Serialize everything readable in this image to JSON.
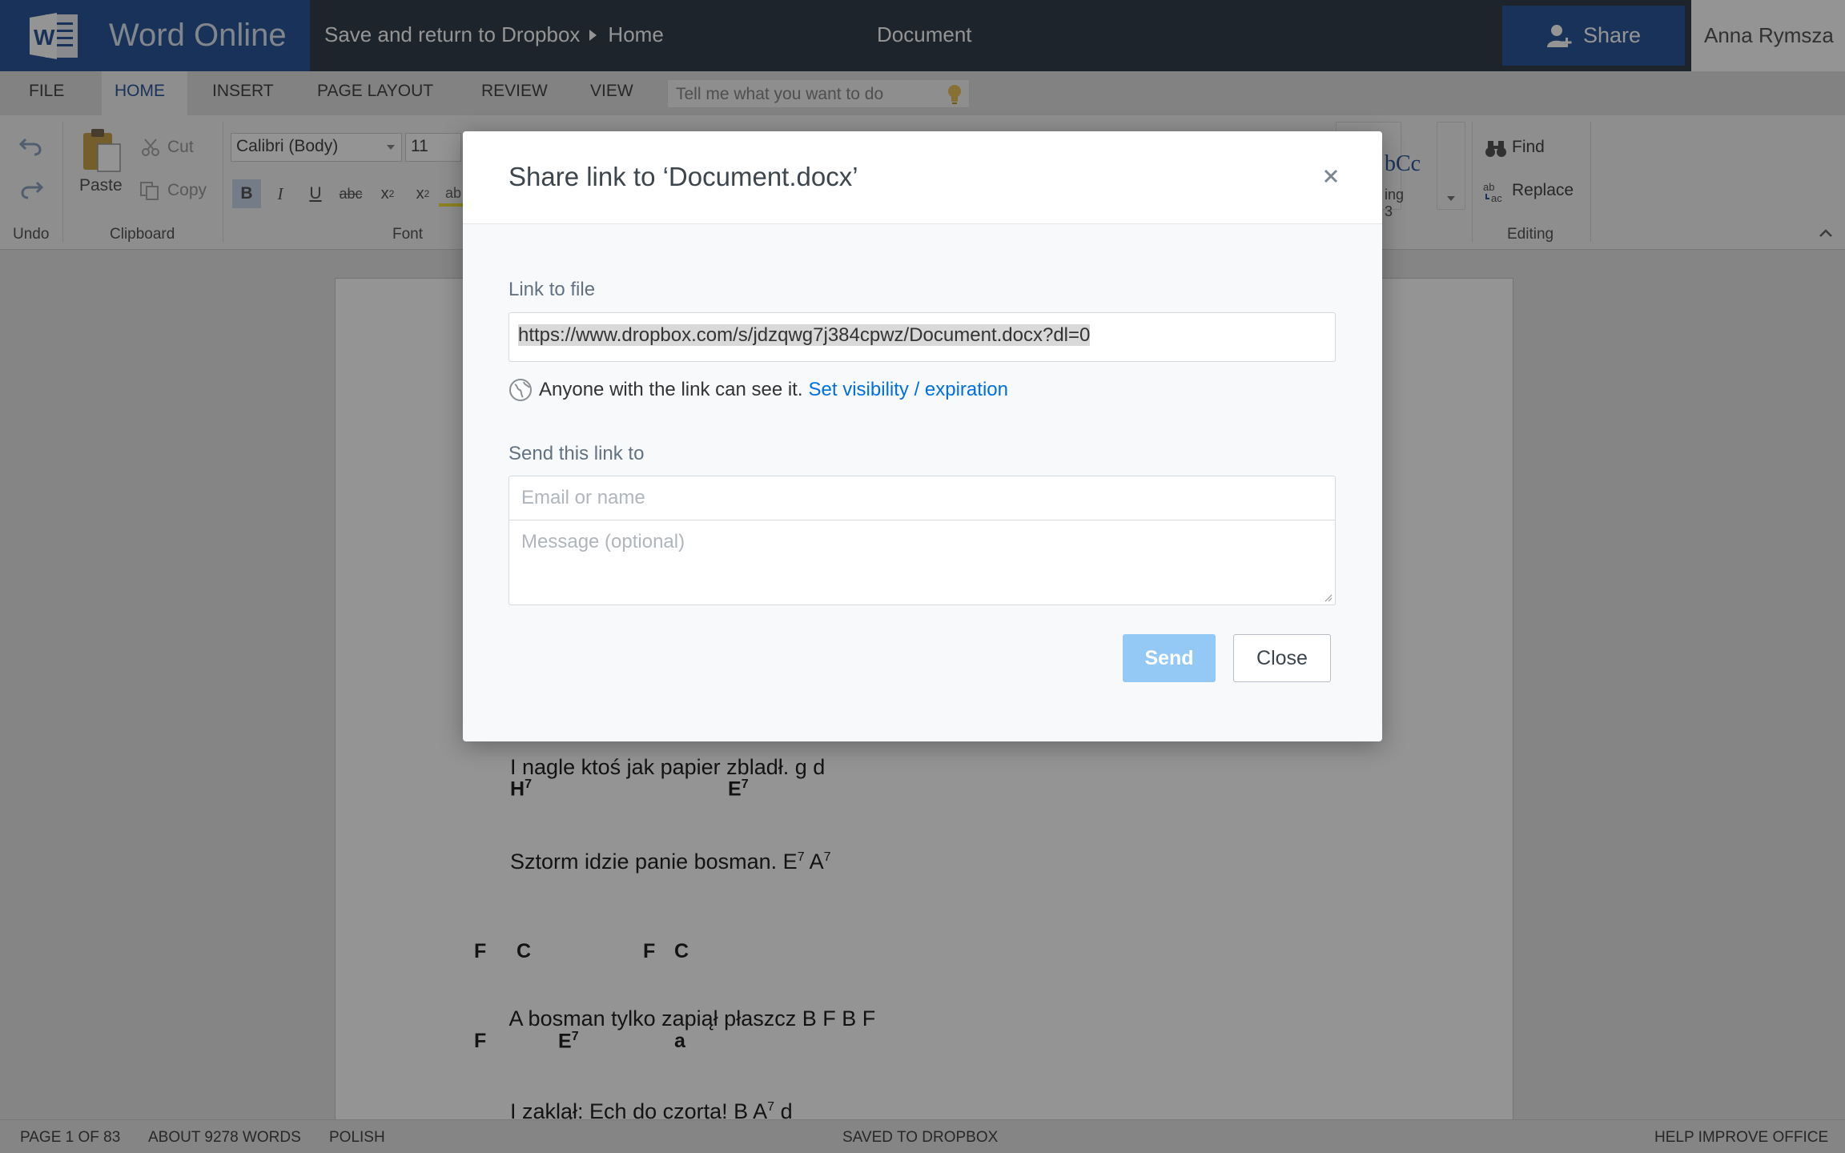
{
  "app": {
    "brand": "Word Online",
    "breadcrumb": [
      "Save and return to Dropbox",
      "Home"
    ],
    "document_title": "Document",
    "share_label": "Share",
    "user_name": "Anna Rymsza"
  },
  "tabs": [
    "FILE",
    "HOME",
    "INSERT",
    "PAGE LAYOUT",
    "REVIEW",
    "VIEW"
  ],
  "active_tab": "HOME",
  "tell_me_placeholder": "Tell me what you want to do",
  "ribbon": {
    "undo_group": "Undo",
    "clipboard": {
      "paste": "Paste",
      "cut": "Cut",
      "copy": "Copy",
      "group": "Clipboard"
    },
    "font": {
      "name": "Calibri (Body)",
      "size": "11",
      "group": "Font"
    },
    "styles_preview": "bCc",
    "styles_label": "ing 3",
    "editing": {
      "find": "Find",
      "replace": "Replace",
      "group": "Editing"
    }
  },
  "document_lines": {
    "l1": "I nagle ktoś jak papier zbladł. g d",
    "c1a": "H",
    "c1b": "E",
    "l2_pre": "Sztorm idzie panie bosman. E",
    "l2_mid": " A",
    "c2a": "F",
    "c2b": "C",
    "c2c": "F",
    "c2d": "C",
    "l3": "A bosman tylko zapiął płaszcz B F B F",
    "c3a": "F",
    "c3b": "E",
    "c3c": "a",
    "l4_pre": "I zaklął: Ech do czorta! B A",
    "l4_post": " d",
    "sup": "7"
  },
  "status": {
    "page": "PAGE 1 OF 83",
    "words": "ABOUT 9278 WORDS",
    "language": "POLISH",
    "saved": "SAVED TO DROPBOX",
    "help": "HELP IMPROVE OFFICE"
  },
  "dialog": {
    "title": "Share link to ‘Document.docx’",
    "link_label": "Link to file",
    "link_url": "https://www.dropbox.com/s/jdzqwg7j384cpwz/Document.docx?dl=0",
    "visibility_text": "Anyone with the link can see it.",
    "visibility_link": "Set visibility / expiration",
    "send_label": "Send this link to",
    "email_placeholder": "Email or name",
    "message_placeholder": "Message (optional)",
    "send_button": "Send",
    "close_button": "Close",
    "colors": {
      "primary": "#0070e0",
      "send_disabled": "#93c9f4",
      "word_blue": "#2b579a"
    }
  }
}
